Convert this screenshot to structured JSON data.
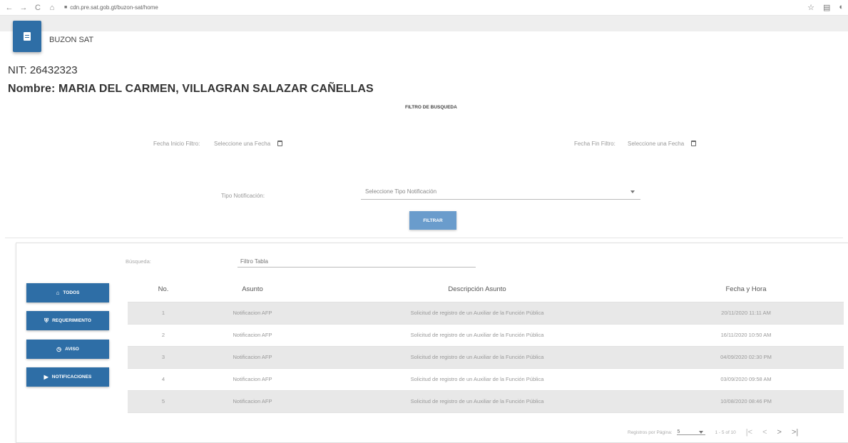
{
  "browser": {
    "url": "cdn.pre.sat.gob.gt/buzon-sat/home",
    "back": "←",
    "forward": "→",
    "reload": "C",
    "home": "⌂"
  },
  "app": {
    "name": "BUZON SAT"
  },
  "contribuyente": {
    "nit": "NIT: 26432323",
    "nombre": "Nombre: MARIA DEL CARMEN, VILLAGRAN SALAZAR CAÑELLAS"
  },
  "filtro": {
    "title": "FILTRO DE BUSQUEDA",
    "fecha_inicio_label": "Fecha Inicio Filtro:",
    "fecha_inicio_placeholder": "Seleccione una Fecha",
    "fecha_fin_label": "Fecha Fin Filtro:",
    "fecha_fin_placeholder": "Seleccione una Fecha",
    "tipo_label": "Tipo Notificación:",
    "tipo_placeholder": "Seleccione Tipo Notificación",
    "button": "FILTRAR"
  },
  "busqueda": {
    "label": "Búsqueda:",
    "placeholder": "Filtro Tabla"
  },
  "sidebar": {
    "items": [
      {
        "label": "TODOS",
        "icon": "home-icon",
        "glyph": "⌂"
      },
      {
        "label": "REQUERIMIENTO",
        "icon": "shield-icon",
        "glyph": "⛨"
      },
      {
        "label": "AVISO",
        "icon": "clock-icon",
        "glyph": "◷"
      },
      {
        "label": "NOTIFICACIONES",
        "icon": "label-icon",
        "glyph": "▶"
      }
    ]
  },
  "table": {
    "headers": [
      "No.",
      "Asunto",
      "Descripción Asunto",
      "Fecha y Hora"
    ],
    "rows": [
      {
        "no": "1",
        "asunto": "Notificacion AFP",
        "descripcion": "Solicitud de registro de un Auxiliar de la Función Pública",
        "fecha": "20/11/2020 11:11 AM"
      },
      {
        "no": "2",
        "asunto": "Notificacion AFP",
        "descripcion": "Solicitud de registro de un Auxiliar de la Función Pública",
        "fecha": "16/11/2020 10:50 AM"
      },
      {
        "no": "3",
        "asunto": "Notificacion AFP",
        "descripcion": "Solicitud de registro de un Auxiliar de la Función Pública",
        "fecha": "04/09/2020 02:30 PM"
      },
      {
        "no": "4",
        "asunto": "Notificacion AFP",
        "descripcion": "Solicitud de registro de un Auxiliar de la Función Pública",
        "fecha": "03/09/2020 09:58 AM"
      },
      {
        "no": "5",
        "asunto": "Notificacion AFP",
        "descripcion": "Solicitud de registro de un Auxiliar de la Función Pública",
        "fecha": "10/08/2020 08:46 PM"
      }
    ]
  },
  "paginator": {
    "label": "Registros por Página:",
    "page_size": "5",
    "range": "1 - 5 of 10",
    "first": "|<",
    "prev": "<",
    "next": ">",
    "last": ">|"
  }
}
